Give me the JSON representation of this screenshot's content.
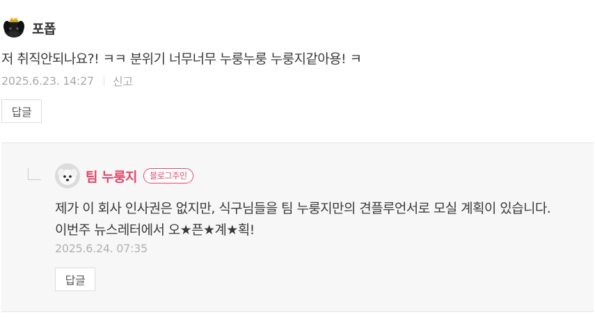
{
  "comment": {
    "author": "포폽",
    "text": "저 취직안되나요?! ㅋㅋ 분위기 너무너무 누룽누룽 누룽지같아용! ㅋ",
    "timestamp": "2025.6.23. 14:27",
    "report_label": "신고",
    "reply_label": "답글",
    "avatar_icon": "black-dog-avatar-icon"
  },
  "reply": {
    "author": "팀 누룽지",
    "badge": "블로그주인",
    "lines": [
      "제가 이 회사 인사권은 없지만, 식구님들을 팀 누룽지만의 견플루언서로 모실 계획이 있습니다.",
      "이번주 뉴스레터에서 오★픈★계★획!"
    ],
    "timestamp": "2025.6.24. 07:35",
    "reply_label": "답글",
    "avatar_icon": "white-puppy-avatar-icon"
  },
  "colors": {
    "accent": "#e0476b",
    "text": "#3a3a3a",
    "meta": "#a8a8a8",
    "reply_bg": "#f7f7f7"
  }
}
